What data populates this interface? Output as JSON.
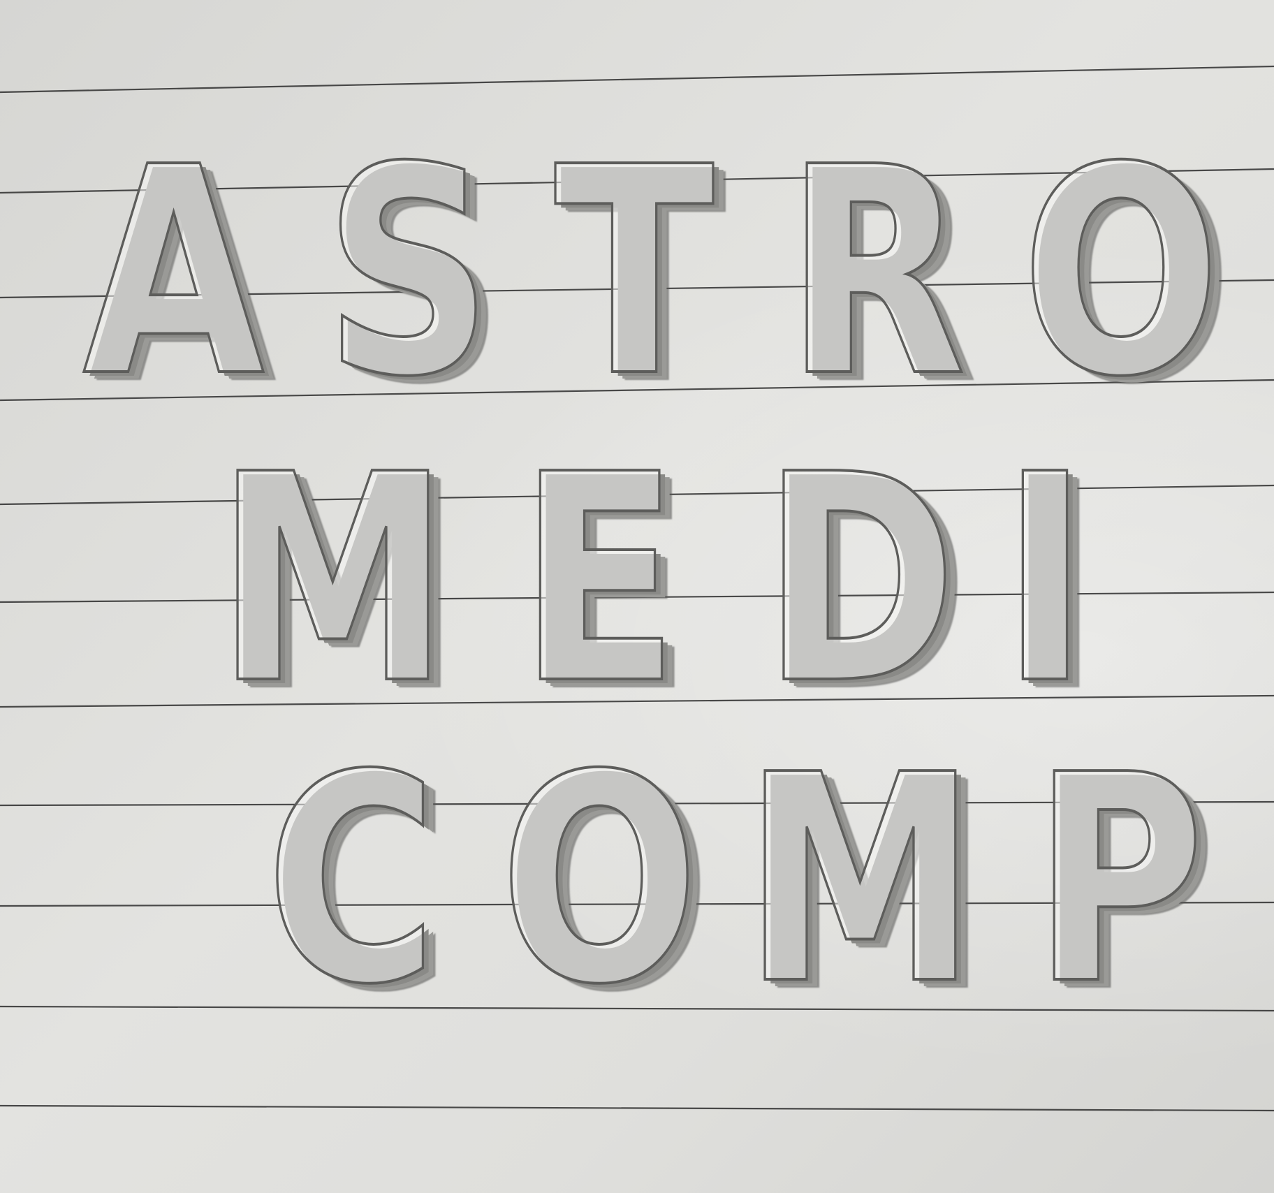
{
  "drawing": {
    "line1": [
      "A",
      "S",
      "T",
      "R",
      "O"
    ],
    "line2": [
      "M",
      "E",
      "D",
      "I"
    ],
    "line3": [
      "C",
      "O",
      "M",
      "P"
    ]
  }
}
